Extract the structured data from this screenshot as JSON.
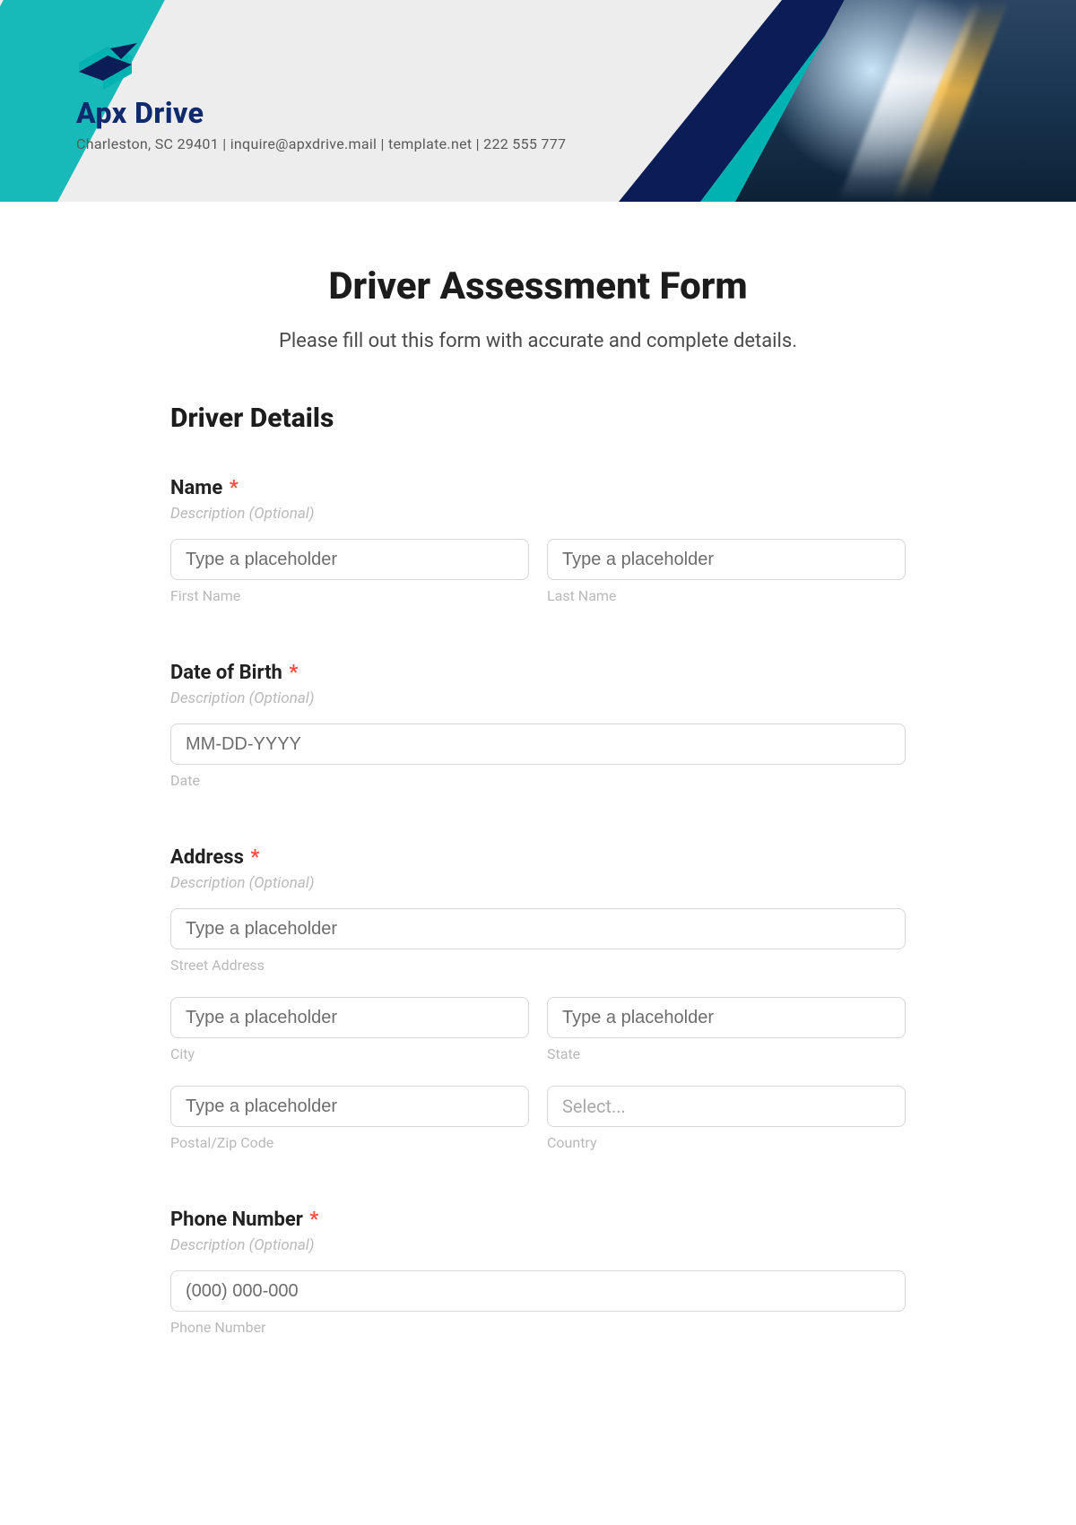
{
  "brand": {
    "name": "Apx Drive",
    "tagline": "Charleston, SC 29401 | inquire@apxdrive.mail | template.net | 222 555 777"
  },
  "form": {
    "title": "Driver Assessment Form",
    "subtitle": "Please fill out this form with accurate and complete details.",
    "section1_title": "Driver Details",
    "required_mark": "*",
    "desc_placeholder": "Description (Optional)",
    "text_placeholder": "Type a placeholder",
    "select_placeholder": "Select...",
    "fields": {
      "name": {
        "label": "Name",
        "first_sub": "First Name",
        "last_sub": "Last Name"
      },
      "dob": {
        "label": "Date of Birth",
        "placeholder": "MM-DD-YYYY",
        "sub": "Date"
      },
      "address": {
        "label": "Address",
        "street_sub": "Street Address",
        "city_sub": "City",
        "state_sub": "State",
        "postal_sub": "Postal/Zip Code",
        "country_sub": "Country"
      },
      "phone": {
        "label": "Phone Number",
        "placeholder": "(000) 000-000",
        "sub": "Phone Number"
      }
    }
  },
  "colors": {
    "accent_teal": "#00b2b2",
    "brand_navy": "#102a6e",
    "required_red": "#ff4b3e"
  }
}
